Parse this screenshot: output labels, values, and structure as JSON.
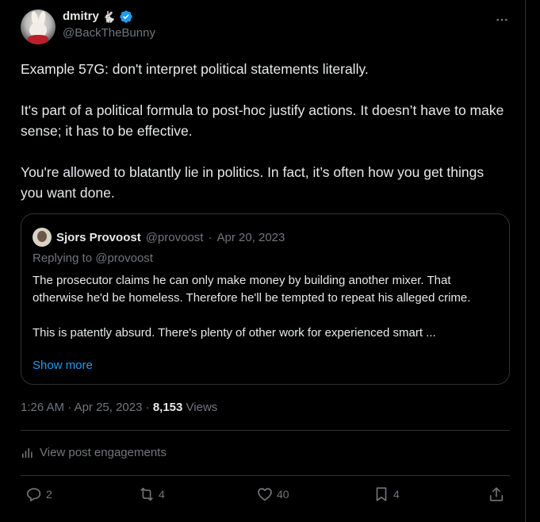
{
  "author": {
    "display_name": "dmitry",
    "emoji": "🐇",
    "handle": "@BackTheBunny",
    "verified": true
  },
  "more_icon": "more-horizontal-icon",
  "tweet": {
    "paragraphs": [
      "Example 57G: don't interpret political statements literally.",
      "It's part of a political formula to post-hoc justify actions. It doesn’t have to make sense; it has to be effective.",
      "You're allowed to blatantly lie in politics. In fact, it’s often how you get things you want done."
    ]
  },
  "quote": {
    "display_name": "Sjors Provoost",
    "handle": "@provoost",
    "date": "Apr 20, 2023",
    "reply_label": "Replying to @provoost",
    "paragraphs": [
      "The prosecutor claims he can only make money by building another mixer. That otherwise he'd be homeless. Therefore he'll be tempted to repeat his alleged crime.",
      "This is patently absurd. There's plenty of other work for experienced smart ..."
    ],
    "show_more": "Show more"
  },
  "meta": {
    "time": "1:26 AM",
    "date": "Apr 25, 2023",
    "views_count": "8,153",
    "views_label": "Views"
  },
  "engagements_label": "View post engagements",
  "actions": {
    "replies": "2",
    "reposts": "4",
    "likes": "40",
    "bookmarks": "4"
  },
  "colors": {
    "background": "#000000",
    "text": "#e7e9ea",
    "muted": "#71767b",
    "accent": "#1d9bf0",
    "border": "#2f3336"
  }
}
